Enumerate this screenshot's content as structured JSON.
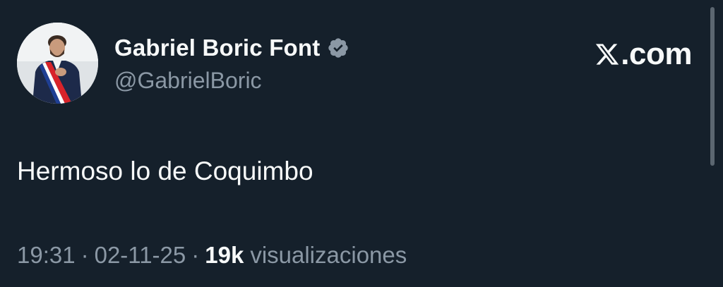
{
  "author": {
    "display_name": "Gabriel Boric Font",
    "handle": "@GabrielBoric",
    "verified": true,
    "avatar_icon": "profile-photo"
  },
  "site": {
    "logo_icon": "x-logo-icon",
    "text": ".com"
  },
  "tweet": {
    "text": "Hermoso lo de Coquimbo"
  },
  "meta": {
    "time": "19:31",
    "separator": "·",
    "date": "02-11-25",
    "views_count": "19k",
    "views_label": "visualizaciones"
  },
  "colors": {
    "background": "#15202b",
    "primary_text": "#f7f9f9",
    "secondary_text": "#8b98a5",
    "verified_badge": "#8b98a5"
  }
}
